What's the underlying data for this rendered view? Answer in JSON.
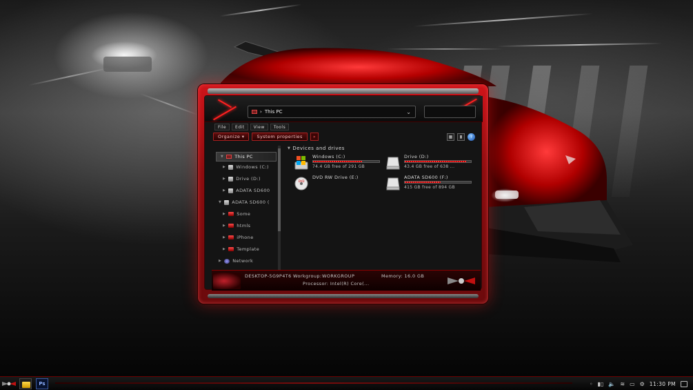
{
  "window": {
    "address_path": "This PC",
    "menu": [
      "File",
      "Edit",
      "View",
      "Tools"
    ],
    "commands": {
      "organize": "Organize",
      "system_properties": "System properties",
      "more": "»"
    }
  },
  "nav_tree": [
    {
      "label": "This PC",
      "icon": "computer-icon",
      "selected": true
    },
    {
      "label": "Windows (C:)",
      "icon": "drive-icon"
    },
    {
      "label": "Drive (D:)",
      "icon": "drive-icon"
    },
    {
      "label": "ADATA SD600",
      "icon": "drive-icon"
    },
    {
      "label": "ADATA SD600 (",
      "icon": "drive-icon"
    },
    {
      "label": "Some",
      "icon": "folder-icon"
    },
    {
      "label": "htmls",
      "icon": "folder-icon"
    },
    {
      "label": "iPhone",
      "icon": "folder-icon"
    },
    {
      "label": "Template",
      "icon": "folder-icon"
    },
    {
      "label": "Network",
      "icon": "network-icon"
    }
  ],
  "content": {
    "group_header": "Devices and drives",
    "drives": [
      {
        "name": "Windows (C:)",
        "free_text": "74.4 GB free of 291 GB",
        "used_fraction": 0.74,
        "icon": "windows-drive-icon"
      },
      {
        "name": "Drive (D:)",
        "free_text": "43.4 GB free of 638 ...",
        "used_fraction": 0.93,
        "icon": "hard-drive-icon"
      },
      {
        "name": "DVD RW Drive (E:)",
        "free_text": "",
        "used_fraction": null,
        "icon": "dvd-drive-icon"
      },
      {
        "name": "ADATA SD600 (F:)",
        "free_text": "415 GB free of 894 GB",
        "used_fraction": 0.54,
        "icon": "hard-drive-icon"
      }
    ]
  },
  "status": {
    "line1_pc": "DESKTOP-5G9P4T6",
    "line1_workgroup": "Workgroup:",
    "line1_workgroup_value": "WORKGROUP",
    "line1_memory": "Memory: 16.0 GB",
    "line2": "Processor: Intel(R) Core(..."
  },
  "taskbar": {
    "apps": [
      {
        "name": "file-explorer"
      },
      {
        "name": "photoshop",
        "label": "Ps"
      }
    ],
    "clock": "11:30 PM"
  },
  "colors": {
    "accent": "#d0141a",
    "dark": "#141414"
  }
}
